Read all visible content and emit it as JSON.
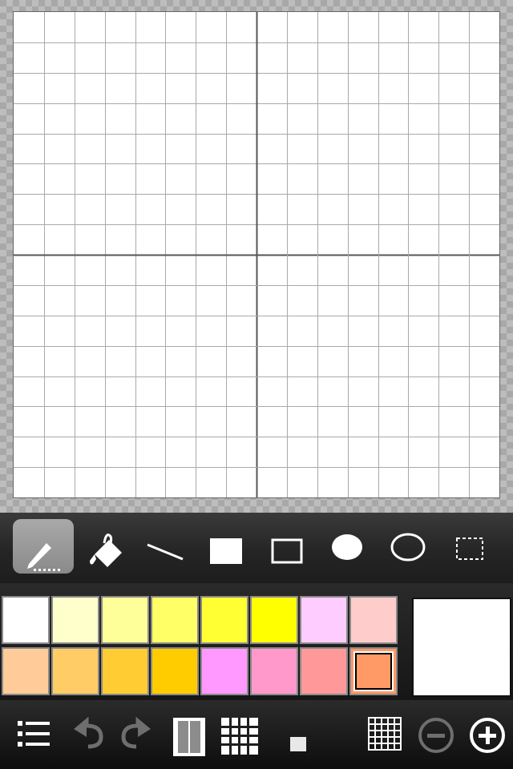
{
  "canvas": {
    "grid_cells": 16,
    "major_every": 8
  },
  "tools": [
    {
      "name": "pencil",
      "active": true
    },
    {
      "name": "fill-bucket",
      "active": false
    },
    {
      "name": "line",
      "active": false
    },
    {
      "name": "filled-rectangle",
      "active": false
    },
    {
      "name": "rectangle",
      "active": false
    },
    {
      "name": "filled-ellipse",
      "active": false
    },
    {
      "name": "ellipse",
      "active": false
    },
    {
      "name": "selection",
      "active": false
    }
  ],
  "palette": {
    "row1": [
      "#ffffff",
      "#ffffcc",
      "#ffff99",
      "#ffff66",
      "#ffff33",
      "#ffff00",
      "#ffccff",
      "#ffcccc"
    ],
    "row2": [
      "#ffcc99",
      "#ffcc66",
      "#ffcc33",
      "#ffcc00",
      "#ff99ff",
      "#ff99cc",
      "#ff9999",
      "#ff9966"
    ],
    "selected": "#ff9966"
  },
  "current_color": "#ffffff",
  "bottom_bar": [
    "menu-icon",
    "undo-icon",
    "redo-icon",
    "frames-icon",
    "dot-grid-icon",
    "brush-size-icon",
    "grid-toggle-icon",
    "zoom-out-icon",
    "zoom-in-icon"
  ]
}
